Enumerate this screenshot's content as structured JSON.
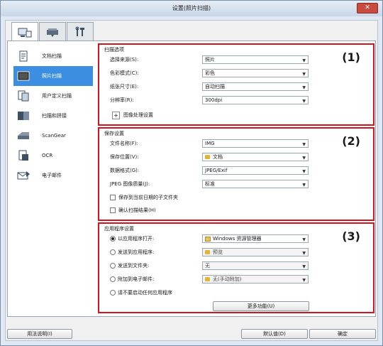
{
  "window": {
    "title": "设置(照片扫描)",
    "close_label": "✕"
  },
  "top_tabs": [
    {
      "name": "scan-from-computer-tab",
      "icon": "computer-scan-icon"
    },
    {
      "name": "scan-from-panel-tab",
      "icon": "scanner-panel-icon"
    },
    {
      "name": "general-settings-tab",
      "icon": "tools-icon"
    }
  ],
  "sidebar": {
    "items": [
      {
        "label": "文档扫描",
        "icon": "document-scan-icon"
      },
      {
        "label": "照片扫描",
        "icon": "photo-scan-icon",
        "selected": true
      },
      {
        "label": "用户定义扫描",
        "icon": "custom-scan-icon"
      },
      {
        "label": "扫描和拼接",
        "icon": "stitch-icon"
      },
      {
        "label": "ScanGear",
        "icon": "scangear-icon"
      },
      {
        "label": "OCR",
        "icon": "ocr-icon"
      },
      {
        "label": "电子邮件",
        "icon": "email-icon"
      }
    ]
  },
  "section1": {
    "title": "扫描选项",
    "number": "(1)",
    "rows": [
      {
        "label": "选择来源(S):",
        "value": "照片"
      },
      {
        "label": "色彩模式(C):",
        "value": "彩色"
      },
      {
        "label": "纸张尺寸(E):",
        "value": "自动扫描"
      },
      {
        "label": "分辨率(R):",
        "value": "300dpi"
      }
    ],
    "image_processing_label": "图像处理设置"
  },
  "section2": {
    "title": "保存设置",
    "number": "(2)",
    "rows": [
      {
        "label": "文件名称(F):",
        "value": "IMG"
      },
      {
        "label": "保存位置(V):",
        "value": "文档"
      },
      {
        "label": "数据格式(G):",
        "value": "JPEG/Exif"
      },
      {
        "label": "JPEG 图像质量(J):",
        "value": "标准"
      }
    ],
    "checkbox1": "保存到当前日期的子文件夹",
    "checkbox2": "确认扫描结果(H)"
  },
  "section3": {
    "title": "应用程序设置",
    "number": "(3)",
    "rows": [
      {
        "label": "以应用程序打开:",
        "value": "Windows 资源管理器",
        "checked": true
      },
      {
        "label": "发送到应用程序:",
        "value": "预览"
      },
      {
        "label": "发送到文件夹:",
        "value": "无"
      },
      {
        "label": "附加到电子邮件:",
        "value": "无(手动附加)"
      }
    ],
    "no_app_label": "请不要启动任何应用程序",
    "more_functions": "更多功能(U)"
  },
  "footer": {
    "help": "用法说明(I)",
    "defaults": "默认值(D)",
    "ok": "确定"
  }
}
